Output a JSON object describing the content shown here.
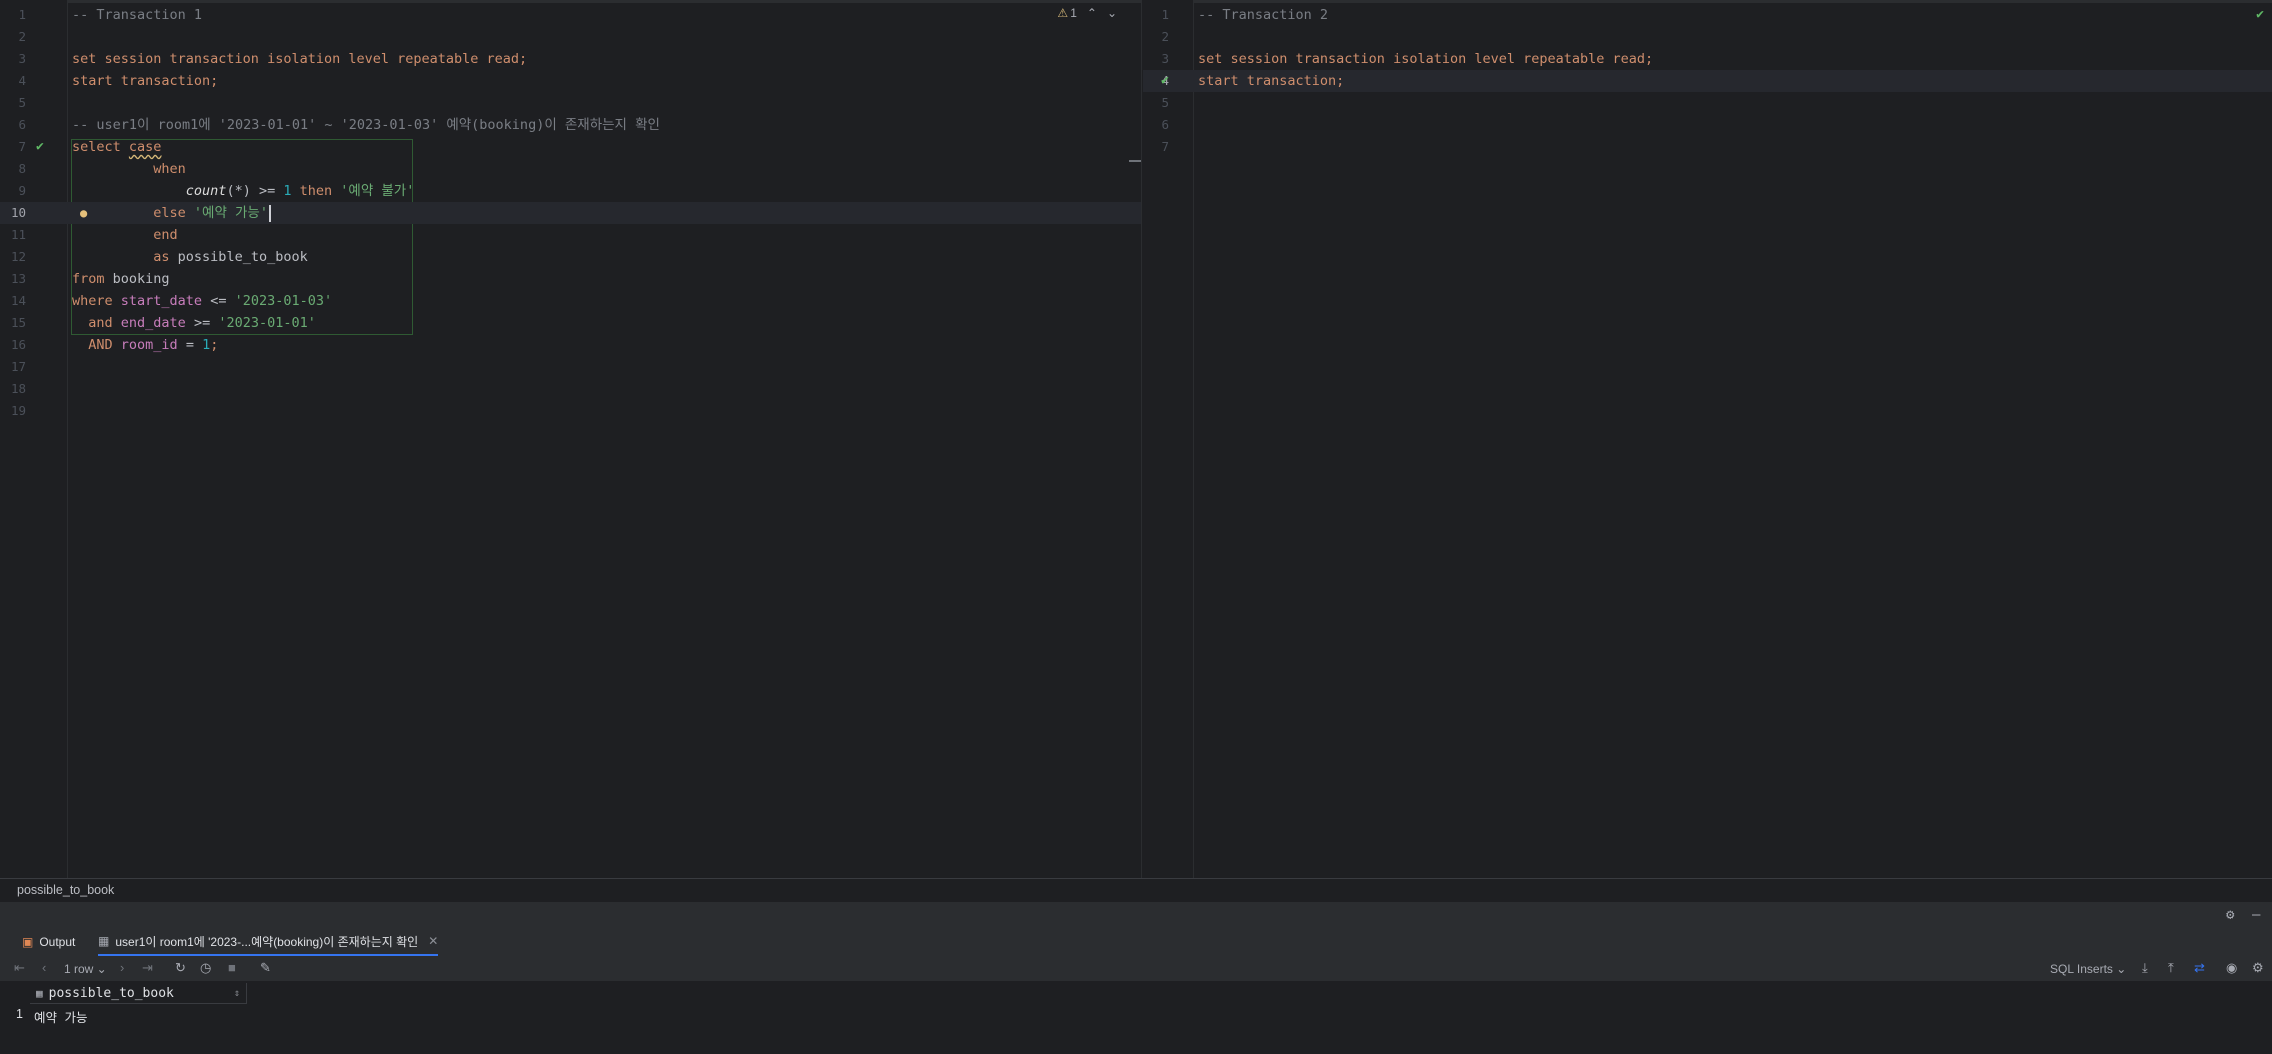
{
  "editor1": {
    "lines": [
      {
        "n": "1",
        "tokens": [
          {
            "t": "-- Transaction 1",
            "c": "cm"
          }
        ]
      },
      {
        "n": "2",
        "tokens": []
      },
      {
        "n": "3",
        "tokens": [
          {
            "t": "set session transaction isolation level repeatable read;",
            "c": "kw"
          }
        ]
      },
      {
        "n": "4",
        "tokens": [
          {
            "t": "start transaction;",
            "c": "kw"
          }
        ]
      },
      {
        "n": "5",
        "tokens": []
      },
      {
        "n": "6",
        "tokens": [
          {
            "t": "-- user1이 room1에 '2023-01-01' ~ '2023-01-03' 예약(booking)이 존재하는지 확인",
            "c": "cm"
          }
        ]
      },
      {
        "n": "7",
        "tokens": [
          {
            "t": "select ",
            "c": "kw"
          },
          {
            "t": "case",
            "c": "kw wavy"
          }
        ]
      },
      {
        "n": "8",
        "tokens": [
          {
            "t": "          when",
            "c": "kw"
          }
        ]
      },
      {
        "n": "9",
        "tokens": [
          {
            "t": "              ",
            "c": "id"
          },
          {
            "t": "count",
            "c": "fn"
          },
          {
            "t": "(*) >= ",
            "c": "op"
          },
          {
            "t": "1",
            "c": "num"
          },
          {
            "t": " then ",
            "c": "kw"
          },
          {
            "t": "'예약 불가'",
            "c": "str"
          }
        ]
      },
      {
        "n": "10",
        "tokens": [
          {
            "t": "          else ",
            "c": "kw"
          },
          {
            "t": "'예약 가능'",
            "c": "str"
          }
        ]
      },
      {
        "n": "11",
        "tokens": [
          {
            "t": "          end",
            "c": "kw"
          }
        ]
      },
      {
        "n": "12",
        "tokens": [
          {
            "t": "          as ",
            "c": "kw"
          },
          {
            "t": "possible_to_book",
            "c": "id"
          }
        ]
      },
      {
        "n": "13",
        "tokens": [
          {
            "t": "from ",
            "c": "kw"
          },
          {
            "t": "booking",
            "c": "id"
          }
        ]
      },
      {
        "n": "14",
        "tokens": [
          {
            "t": "where ",
            "c": "kw"
          },
          {
            "t": "start_date",
            "c": "col"
          },
          {
            "t": " <= ",
            "c": "op"
          },
          {
            "t": "'2023-01-03'",
            "c": "str"
          }
        ]
      },
      {
        "n": "15",
        "tokens": [
          {
            "t": "  and ",
            "c": "kw"
          },
          {
            "t": "end_date",
            "c": "col"
          },
          {
            "t": " >= ",
            "c": "op"
          },
          {
            "t": "'2023-01-01'",
            "c": "str"
          }
        ]
      },
      {
        "n": "16",
        "tokens": [
          {
            "t": "  AND ",
            "c": "kw"
          },
          {
            "t": "room_id",
            "c": "col"
          },
          {
            "t": " = ",
            "c": "op"
          },
          {
            "t": "1",
            "c": "num"
          },
          {
            "t": ";",
            "c": "kw"
          }
        ]
      },
      {
        "n": "17",
        "tokens": []
      },
      {
        "n": "18",
        "tokens": []
      },
      {
        "n": "19",
        "tokens": []
      }
    ],
    "current_line": "10",
    "executed_line": "7",
    "warning_count": "1"
  },
  "editor2": {
    "lines": [
      {
        "n": "1",
        "tokens": [
          {
            "t": "-- Transaction 2",
            "c": "cm"
          }
        ]
      },
      {
        "n": "2",
        "tokens": []
      },
      {
        "n": "3",
        "tokens": [
          {
            "t": "set session transaction isolation level repeatable read;",
            "c": "kw"
          }
        ]
      },
      {
        "n": "4",
        "tokens": [
          {
            "t": "start transaction;",
            "c": "kw"
          }
        ]
      },
      {
        "n": "5",
        "tokens": []
      },
      {
        "n": "6",
        "tokens": []
      },
      {
        "n": "7",
        "tokens": []
      }
    ],
    "current_line": "4",
    "executed_line": "4"
  },
  "breadcrumb": "possible_to_book",
  "services": {
    "tabs": [
      {
        "label": "Output",
        "icon": "output-icon"
      },
      {
        "label": "user1이 room1에 '2023-...예약(booking)이 존재하는지 확인",
        "icon": "table-icon"
      }
    ],
    "active_tab": 1,
    "row_count": "1 row",
    "export_format": "SQL Inserts",
    "result": {
      "columns": [
        "possible_to_book"
      ],
      "rows": [
        [
          "예약 가능"
        ]
      ]
    }
  },
  "colors": {
    "accent": "#3574f0",
    "success": "#5fb865",
    "warning": "#e5c07b"
  }
}
